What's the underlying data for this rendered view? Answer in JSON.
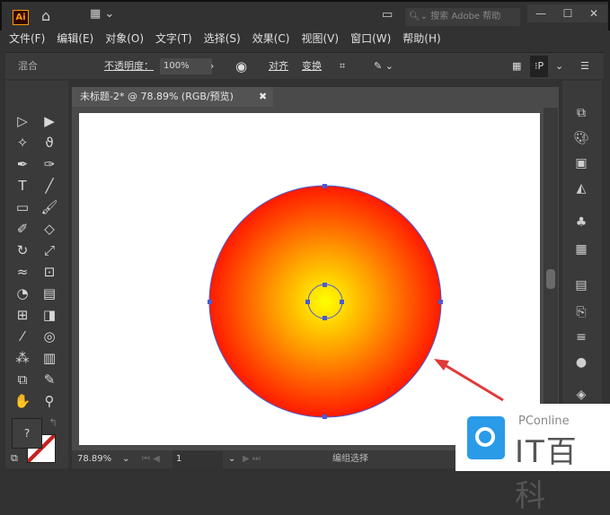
{
  "app": {
    "logo": "Ai",
    "search_placeholder": "搜索 Adobe 帮助"
  },
  "menu": [
    "文件(F)",
    "编辑(E)",
    "对象(O)",
    "文字(T)",
    "选择(S)",
    "效果(C)",
    "视图(V)",
    "窗口(W)",
    "帮助(H)"
  ],
  "options": {
    "blend": "混合",
    "opacity_label": "不透明度：",
    "opacity_value": "100%",
    "align": "对齐",
    "transform": "变换"
  },
  "document": {
    "tab_title": "未标题-2* @ 78.89% (RGB/预览)"
  },
  "status": {
    "zoom": "78.89%",
    "artboard": "1",
    "tool": "编组选择"
  },
  "fill_stroke": {
    "fill_unknown": "?"
  },
  "watermark": {
    "brand": "PConline",
    "name": "IT百科"
  },
  "colors": {
    "gradient_center": "#ffff00",
    "gradient_edge": "#ff0000",
    "selection": "#4a5bd4",
    "arrow": "#e03a3a",
    "logo_blue": "#2a9be8"
  }
}
